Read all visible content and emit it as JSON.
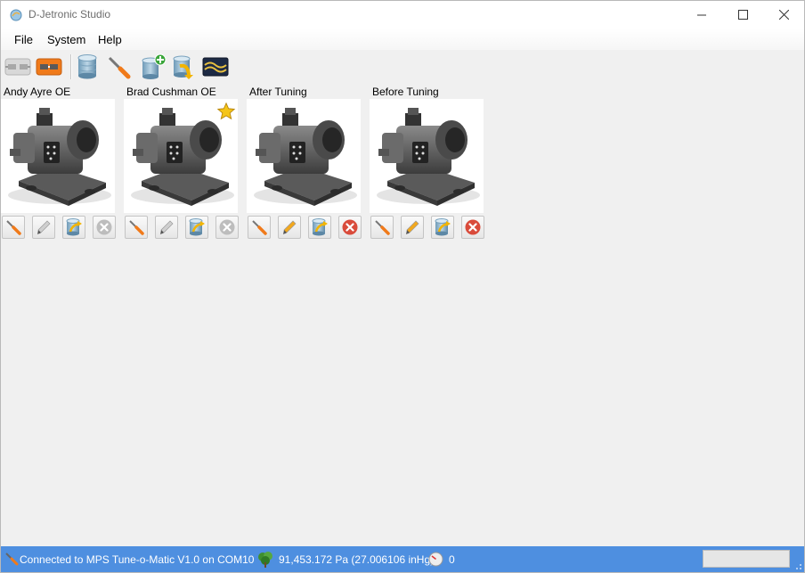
{
  "window": {
    "title": "D-Jetronic Studio"
  },
  "menu": {
    "items": [
      "File",
      "System",
      "Help"
    ]
  },
  "toolbar": {
    "buttons": [
      "disconnect-icon",
      "connect-icon",
      "database-icon",
      "tune-tool-icon",
      "add-database-icon",
      "import-database-icon",
      "waveform-icon"
    ]
  },
  "maps": [
    {
      "name": "Andy Ayre OE",
      "favorite": false,
      "editable": false,
      "deletable": false
    },
    {
      "name": "Brad Cushman OE",
      "favorite": true,
      "editable": false,
      "deletable": false
    },
    {
      "name": "After Tuning",
      "favorite": false,
      "editable": true,
      "deletable": true
    },
    {
      "name": "Before Tuning",
      "favorite": false,
      "editable": true,
      "deletable": true
    }
  ],
  "status": {
    "connection": "Connected to MPS Tune-o-Matic V1.0 on COM10",
    "pressure": "91,453.172 Pa (27.006106 inHg)",
    "rpm": "0"
  },
  "colors": {
    "statusbar": "#4e8fe0",
    "accent_orange": "#f07a1a",
    "delete_red": "#d94b3b"
  }
}
